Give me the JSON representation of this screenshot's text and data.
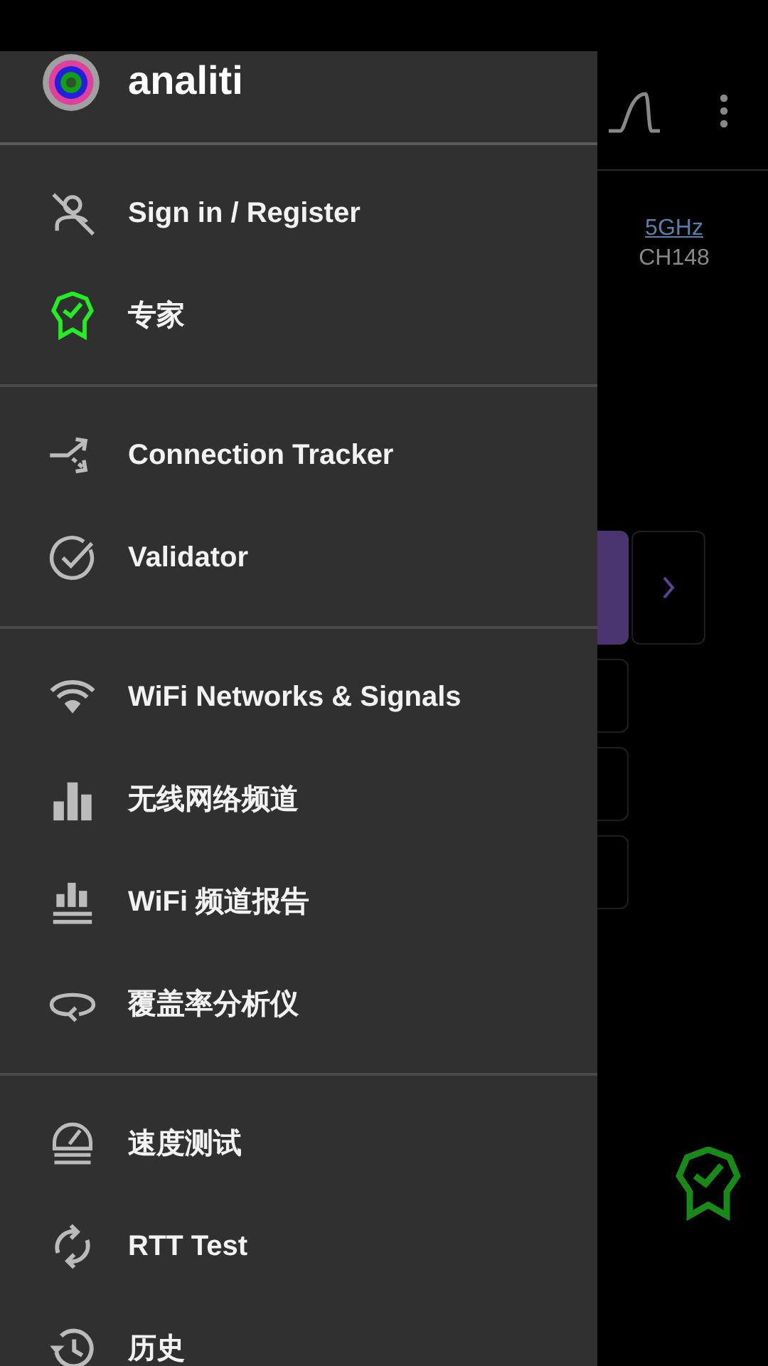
{
  "drawer": {
    "app_name": "analiti",
    "sections": [
      {
        "items": [
          {
            "label": "Sign in / Register"
          },
          {
            "label": "专家"
          }
        ]
      },
      {
        "items": [
          {
            "label": "Connection Tracker"
          },
          {
            "label": "Validator"
          }
        ]
      },
      {
        "items": [
          {
            "label": "WiFi Networks & Signals"
          },
          {
            "label": "无线网络频道"
          },
          {
            "label": "WiFi 频道报告"
          },
          {
            "label": "覆盖率分析仪"
          }
        ]
      },
      {
        "items": [
          {
            "label": "速度测试"
          },
          {
            "label": "RTT Test"
          },
          {
            "label": "历史"
          }
        ]
      }
    ]
  },
  "background": {
    "band_link": "5GHz",
    "channel": "CH148"
  }
}
